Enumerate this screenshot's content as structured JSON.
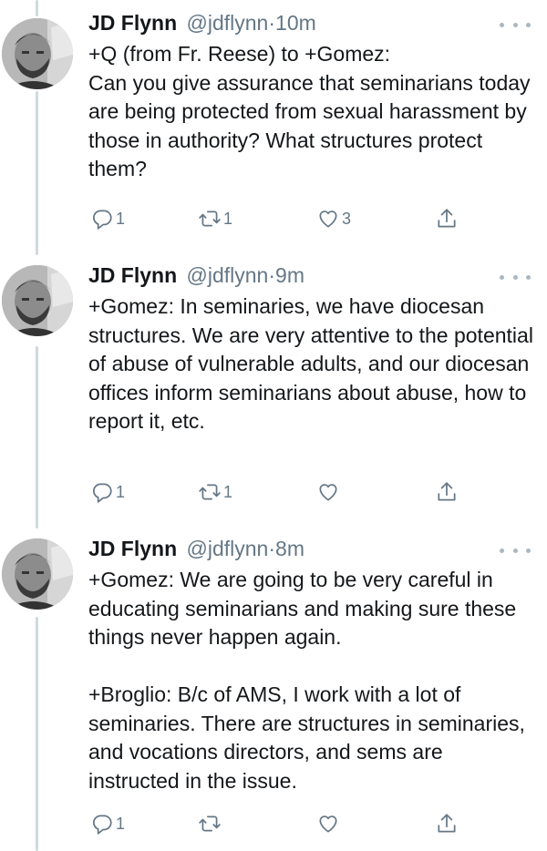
{
  "tweets": [
    {
      "author_name": "JD Flynn",
      "handle": "@jdflynn",
      "separator": "·",
      "time": "10m",
      "text": "+Q (from Fr. Reese) to +Gomez:\nCan you give assurance that seminarians today are being protected from sexual harassment by those in authority? What structures protect them?",
      "reply_count": "1",
      "retweet_count": "1",
      "like_count": "3"
    },
    {
      "author_name": "JD Flynn",
      "handle": "@jdflynn",
      "separator": "·",
      "time": "9m",
      "text": "+Gomez: In seminaries, we have diocesan structures. We are very attentive to the potential of abuse of vulnerable adults, and our diocesan offices inform seminarians about abuse, how to report it, etc.",
      "reply_count": "1",
      "retweet_count": "1",
      "like_count": ""
    },
    {
      "author_name": "JD Flynn",
      "handle": "@jdflynn",
      "separator": "·",
      "time": "8m",
      "text": "+Gomez: We are going to be very careful in educating seminarians and making sure these things never happen again.\n\n+Broglio: B/c of AMS, I work with a lot of seminaries. There are structures in seminaries, and vocations directors, and sems are instructed in the issue.",
      "reply_count": "1",
      "retweet_count": "",
      "like_count": ""
    }
  ],
  "icons": {
    "reply": "reply-icon",
    "retweet": "retweet-icon",
    "like": "heart-icon",
    "share": "share-icon",
    "more": "more-options-icon"
  },
  "colors": {
    "text": "#14171a",
    "muted": "#657786",
    "thread_line": "#cfd9de"
  }
}
